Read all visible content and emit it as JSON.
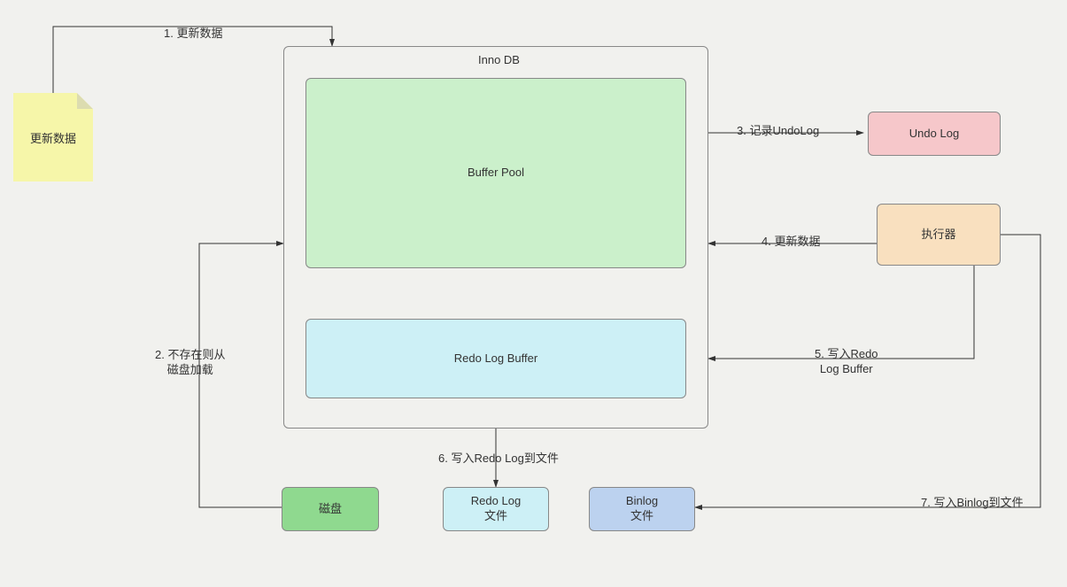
{
  "nodes": {
    "update_data_note": "更新数据",
    "innodb_title": "Inno DB",
    "buffer_pool": "Buffer Pool",
    "redo_log_buffer": "Redo Log Buffer",
    "undo_log": "Undo Log",
    "executor": "执行器",
    "disk": "磁盘",
    "redo_log_file": "Redo Log\n文件",
    "binlog_file": "Binlog\n文件"
  },
  "edges": {
    "e1": "1. 更新数据",
    "e2": "2. 不存在则从\n磁盘加载",
    "e3": "3. 记录UndoLog",
    "e4": "4. 更新数据",
    "e5": "5. 写入Redo\nLog Buffer",
    "e6": "6. 写入Redo Log到文件",
    "e7": "7. 写入Binlog到文件"
  }
}
